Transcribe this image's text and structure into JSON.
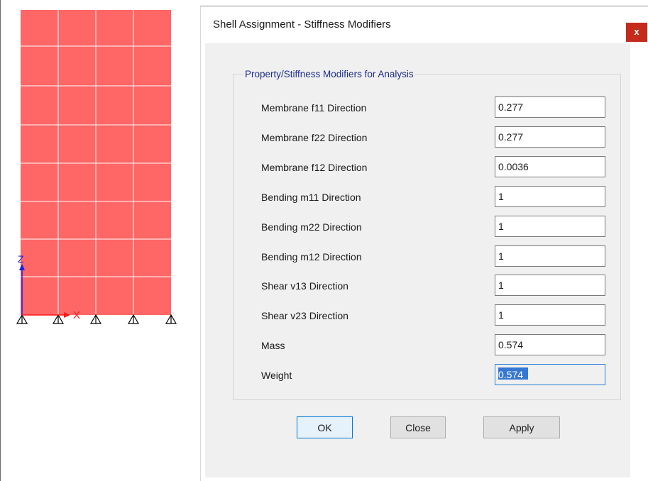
{
  "dialog": {
    "title": "Shell Assignment - Stiffness Modifiers",
    "close_glyph": "x"
  },
  "group": {
    "title": "Property/Stiffness Modifiers for Analysis"
  },
  "modifiers": [
    {
      "label": "Membrane f11 Direction",
      "value": "0.277"
    },
    {
      "label": "Membrane f22 Direction",
      "value": "0.277"
    },
    {
      "label": "Membrane f12 Direction",
      "value": "0.0036"
    },
    {
      "label": "Bending m11 Direction",
      "value": "1"
    },
    {
      "label": "Bending m22 Direction",
      "value": "1"
    },
    {
      "label": "Bending m12 Direction",
      "value": "1"
    },
    {
      "label": "Shear v13 Direction",
      "value": "1"
    },
    {
      "label": "Shear v23 Direction",
      "value": "1"
    },
    {
      "label": "Mass",
      "value": "0.574"
    },
    {
      "label": "Weight",
      "value": "0.574"
    }
  ],
  "buttons": {
    "ok": "OK",
    "close": "Close",
    "apply": "Apply"
  },
  "canvas": {
    "axis_z_label": "Z",
    "axis_x_label": "X",
    "shell_color": "#ff6666",
    "axis_z_color": "#1f1fe0",
    "axis_x_color": "#ff1a1a"
  }
}
